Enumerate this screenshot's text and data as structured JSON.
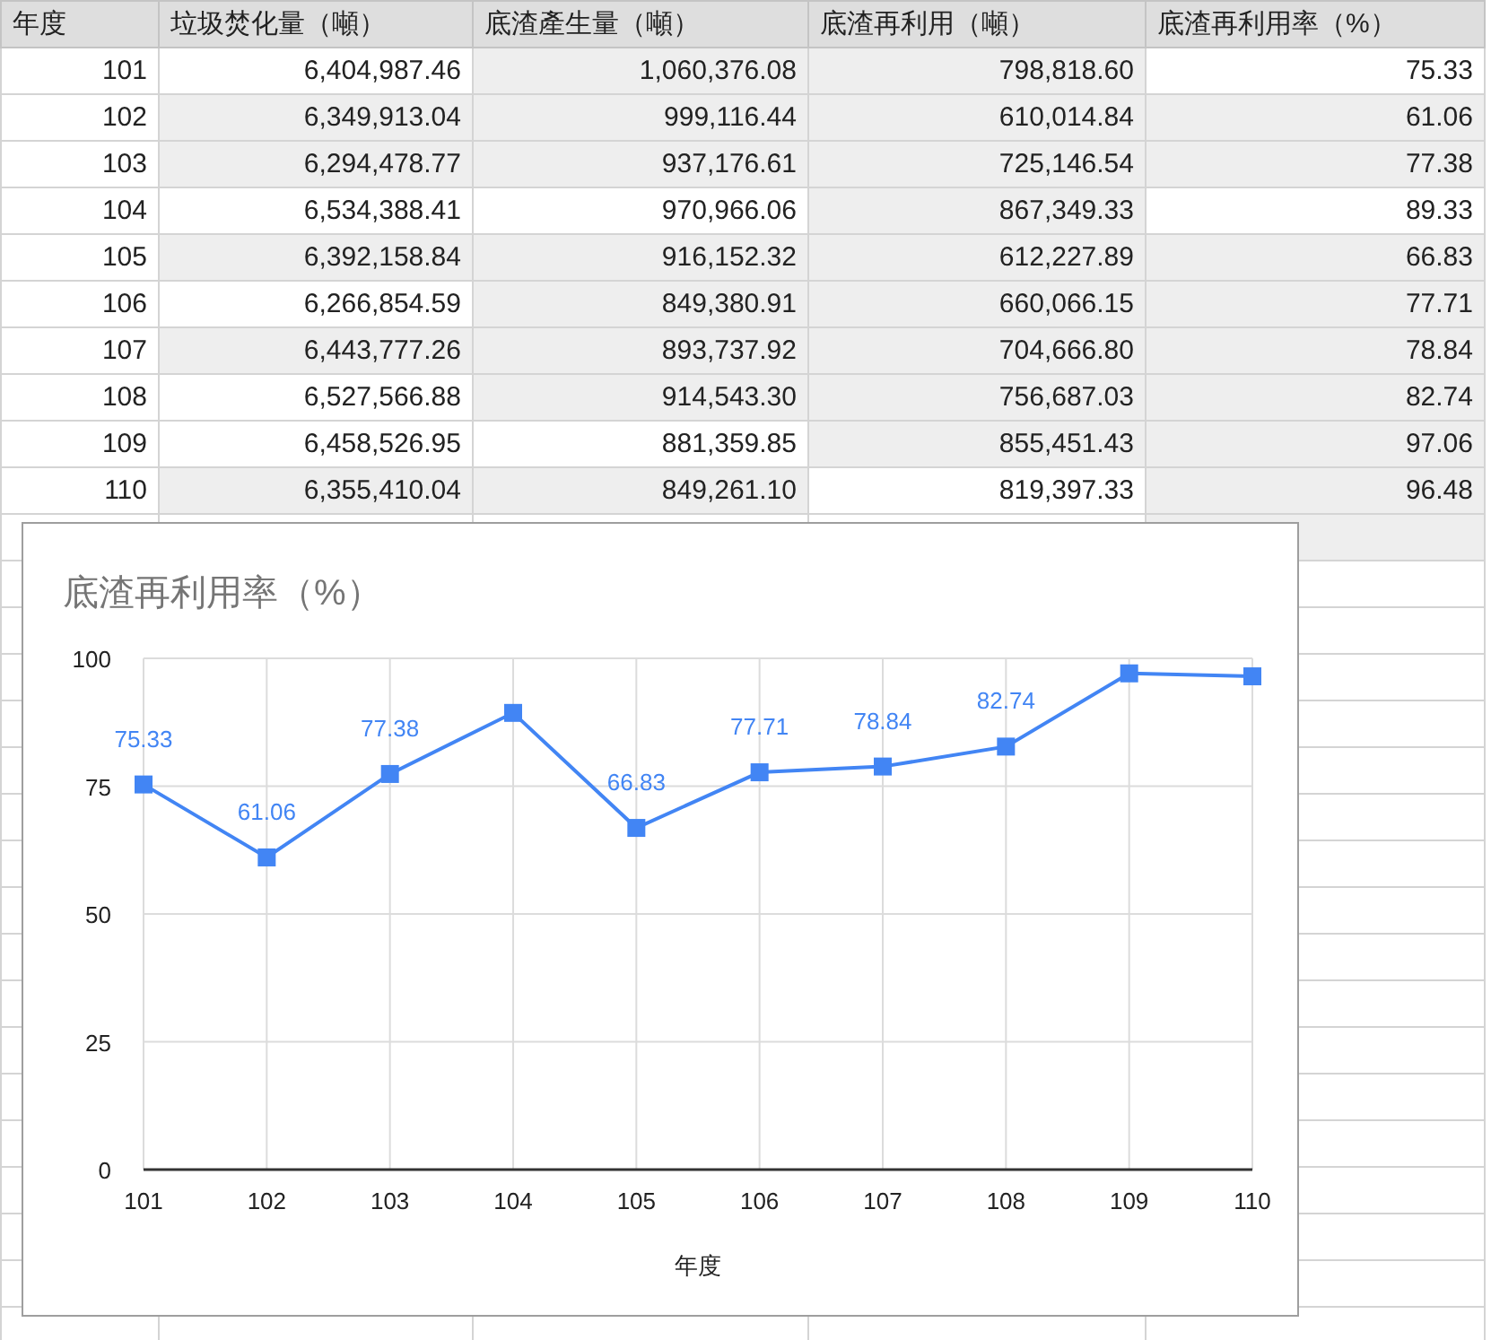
{
  "table": {
    "columns": [
      "年度",
      "垃圾焚化量（噸）",
      "底渣產生量（噸）",
      "底渣再利用（噸）",
      "底渣再利用率（%）"
    ],
    "rows": [
      {
        "cells": [
          {
            "text": "101",
            "shaded": false
          },
          {
            "text": "6,404,987.46",
            "shaded": false
          },
          {
            "text": "1,060,376.08",
            "shaded": true
          },
          {
            "text": "798,818.60",
            "shaded": true
          },
          {
            "text": "75.33",
            "shaded": false
          }
        ]
      },
      {
        "cells": [
          {
            "text": "102",
            "shaded": false
          },
          {
            "text": "6,349,913.04",
            "shaded": true
          },
          {
            "text": "999,116.44",
            "shaded": true
          },
          {
            "text": "610,014.84",
            "shaded": true
          },
          {
            "text": "61.06",
            "shaded": true
          }
        ]
      },
      {
        "cells": [
          {
            "text": "103",
            "shaded": false
          },
          {
            "text": "6,294,478.77",
            "shaded": true
          },
          {
            "text": "937,176.61",
            "shaded": true
          },
          {
            "text": "725,146.54",
            "shaded": true
          },
          {
            "text": "77.38",
            "shaded": true
          }
        ]
      },
      {
        "cells": [
          {
            "text": "104",
            "shaded": false
          },
          {
            "text": "6,534,388.41",
            "shaded": false
          },
          {
            "text": "970,966.06",
            "shaded": false
          },
          {
            "text": "867,349.33",
            "shaded": true
          },
          {
            "text": "89.33",
            "shaded": false
          }
        ]
      },
      {
        "cells": [
          {
            "text": "105",
            "shaded": false
          },
          {
            "text": "6,392,158.84",
            "shaded": true
          },
          {
            "text": "916,152.32",
            "shaded": true
          },
          {
            "text": "612,227.89",
            "shaded": true
          },
          {
            "text": "66.83",
            "shaded": true
          }
        ]
      },
      {
        "cells": [
          {
            "text": "106",
            "shaded": false
          },
          {
            "text": "6,266,854.59",
            "shaded": false
          },
          {
            "text": "849,380.91",
            "shaded": true
          },
          {
            "text": "660,066.15",
            "shaded": true
          },
          {
            "text": "77.71",
            "shaded": true
          }
        ]
      },
      {
        "cells": [
          {
            "text": "107",
            "shaded": false
          },
          {
            "text": "6,443,777.26",
            "shaded": true
          },
          {
            "text": "893,737.92",
            "shaded": true
          },
          {
            "text": "704,666.80",
            "shaded": true
          },
          {
            "text": "78.84",
            "shaded": true
          }
        ]
      },
      {
        "cells": [
          {
            "text": "108",
            "shaded": false
          },
          {
            "text": "6,527,566.88",
            "shaded": false
          },
          {
            "text": "914,543.30",
            "shaded": true
          },
          {
            "text": "756,687.03",
            "shaded": true
          },
          {
            "text": "82.74",
            "shaded": true
          }
        ]
      },
      {
        "cells": [
          {
            "text": "109",
            "shaded": false
          },
          {
            "text": "6,458,526.95",
            "shaded": false
          },
          {
            "text": "881,359.85",
            "shaded": false
          },
          {
            "text": "855,451.43",
            "shaded": true
          },
          {
            "text": "97.06",
            "shaded": true
          }
        ]
      },
      {
        "cells": [
          {
            "text": "110",
            "shaded": false
          },
          {
            "text": "6,355,410.04",
            "shaded": true
          },
          {
            "text": "849,261.10",
            "shaded": true
          },
          {
            "text": "819,397.33",
            "shaded": false
          },
          {
            "text": "96.48",
            "shaded": true
          }
        ]
      }
    ],
    "trailing_row": {
      "cells": [
        {
          "shaded": false
        },
        {
          "shaded": false
        },
        {
          "shaded": false
        },
        {
          "shaded": false
        },
        {
          "shaded": true
        }
      ]
    }
  },
  "chart": {
    "chart_data": {
      "type": "line",
      "title": "底渣再利用率（%）",
      "xlabel": "年度",
      "categories": [
        "101",
        "102",
        "103",
        "104",
        "105",
        "106",
        "107",
        "108",
        "109",
        "110"
      ],
      "grid": true,
      "series": [
        {
          "color": "#4285f4",
          "marker": "square",
          "values": [
            75.33,
            61.06,
            77.38,
            89.33,
            66.83,
            77.71,
            78.84,
            82.74,
            97.06,
            96.48
          ]
        }
      ],
      "value_labels": [
        "75.33",
        "61.06",
        "77.38",
        null,
        "66.83",
        "77.71",
        "78.84",
        "82.74",
        null,
        null
      ],
      "ylim": [
        0,
        100
      ],
      "yticks": [
        0,
        25,
        50,
        75,
        100
      ]
    }
  }
}
